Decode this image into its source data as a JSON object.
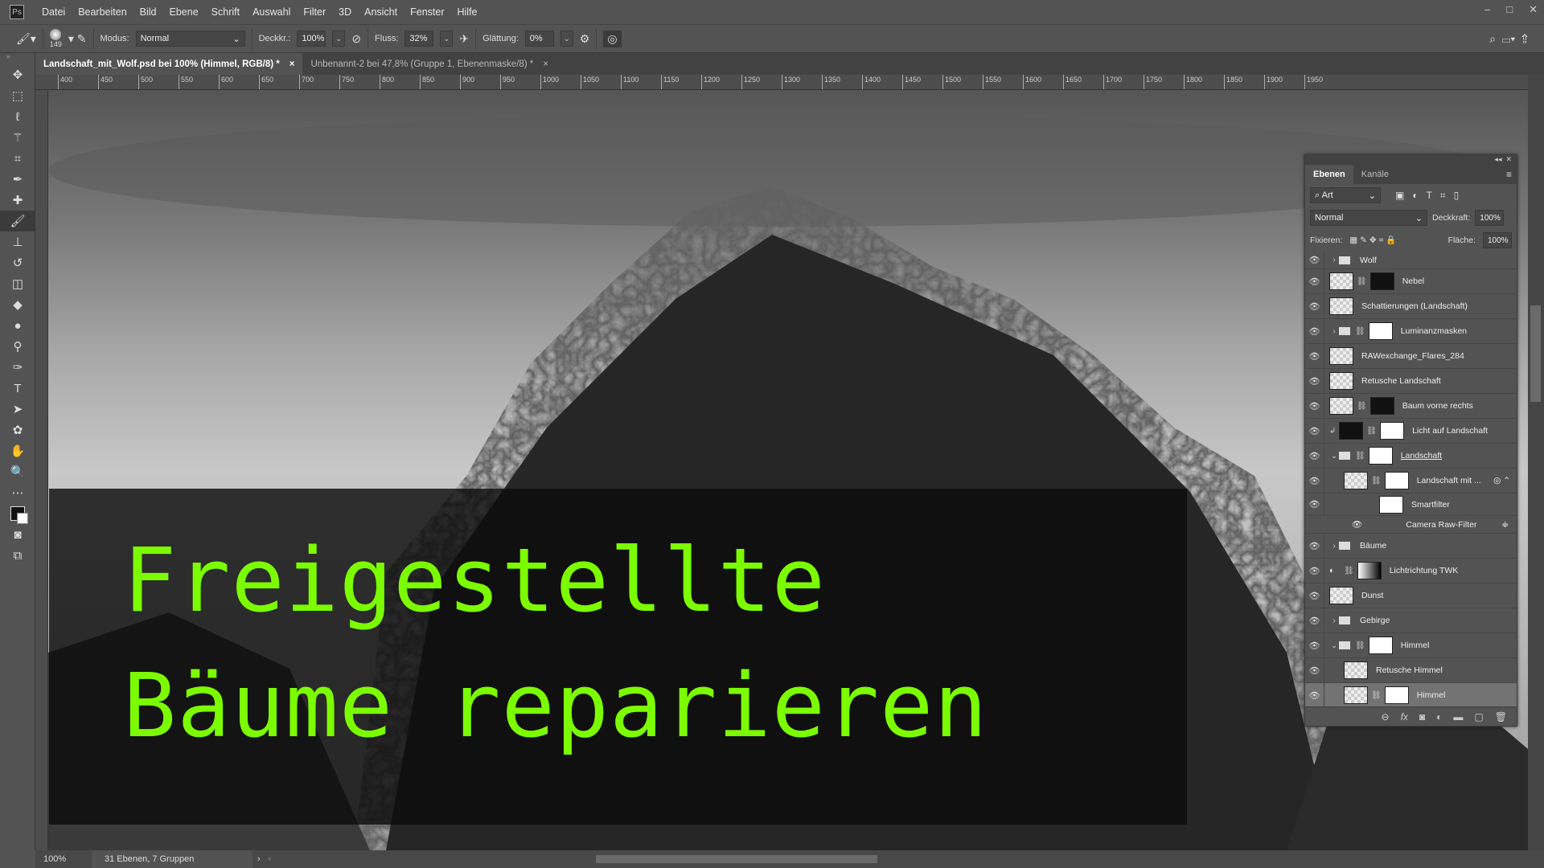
{
  "app": {
    "logo": "Ps",
    "window_controls": [
      "–",
      "□",
      "✕"
    ]
  },
  "menu": [
    "Datei",
    "Bearbeiten",
    "Bild",
    "Ebene",
    "Schrift",
    "Auswahl",
    "Filter",
    "3D",
    "Ansicht",
    "Fenster",
    "Hilfe"
  ],
  "options": {
    "brush_size": "149",
    "mode_label": "Modus:",
    "mode_value": "Normal",
    "opacity_label": "Deckkr.:",
    "opacity_value": "100%",
    "flow_label": "Fluss:",
    "flow_value": "32%",
    "smoothing_label": "Glättung:",
    "smoothing_value": "0%"
  },
  "tabs": [
    {
      "label": "Landschaft_mit_Wolf.psd bei 100% (Himmel, RGB/8) *",
      "active": true
    },
    {
      "label": "Unbenannt-2 bei 47,8% (Gruppe 1, Ebenenmaske/8) *",
      "active": false
    }
  ],
  "ruler": [
    "400",
    "450",
    "500",
    "550",
    "600",
    "650",
    "700",
    "750",
    "800",
    "850",
    "900",
    "950",
    "1000",
    "1050",
    "1100",
    "1150",
    "1200",
    "1250",
    "1300",
    "1350",
    "1400",
    "1450",
    "1500",
    "1550",
    "1600",
    "1650",
    "1700",
    "1750",
    "1800",
    "1850",
    "1900",
    "1950"
  ],
  "overlay": {
    "line1": "Freigestellte",
    "line2": "Bäume reparieren",
    "text_color": "#7cfc00"
  },
  "status": {
    "zoom": "100%",
    "info": "31 Ebenen, 7 Gruppen"
  },
  "layers_panel": {
    "tabs": [
      "Ebenen",
      "Kanäle"
    ],
    "filter": "Art",
    "blend_mode": "Normal",
    "opacity_label": "Deckkraft:",
    "opacity_value": "100%",
    "lock_label": "Fixieren:",
    "fill_label": "Fläche:",
    "fill_value": "100%",
    "layers": [
      {
        "name": "Wolf",
        "type": "group",
        "expanded": false,
        "indent": 0
      },
      {
        "name": "Nebel",
        "type": "layer-mask",
        "indent": 0
      },
      {
        "name": "Schattierungen (Landschaft)",
        "type": "layer",
        "indent": 0
      },
      {
        "name": "Luminanzmasken",
        "type": "group-mask",
        "expanded": false,
        "indent": 0
      },
      {
        "name": "RAWexchange_Flares_284",
        "type": "smart",
        "indent": 0
      },
      {
        "name": "Retusche Landschaft",
        "type": "layer",
        "indent": 0
      },
      {
        "name": "Baum vorne rechts",
        "type": "layer-mask",
        "indent": 0
      },
      {
        "name": "Licht auf Landschaft",
        "type": "clip-mask",
        "indent": 0
      },
      {
        "name": "Landschaft",
        "type": "group-mask",
        "expanded": true,
        "indent": 0
      },
      {
        "name": "Landschaft mit ...",
        "type": "smart-mask",
        "indent": 1
      },
      {
        "name": "Smartfilter",
        "type": "smartfilter",
        "indent": 2
      },
      {
        "name": "Camera Raw-Filter",
        "type": "filter",
        "indent": 2
      },
      {
        "name": "Bäume",
        "type": "group",
        "expanded": false,
        "indent": 0
      },
      {
        "name": "Lichtrichtung TWK",
        "type": "adjustment",
        "indent": 0
      },
      {
        "name": "Dunst",
        "type": "layer",
        "indent": 0
      },
      {
        "name": "Gebirge",
        "type": "group",
        "expanded": false,
        "indent": 0
      },
      {
        "name": "Himmel",
        "type": "group-mask",
        "expanded": true,
        "indent": 0
      },
      {
        "name": "Retusche Himmel",
        "type": "layer",
        "indent": 1
      },
      {
        "name": "Himmel",
        "type": "layer-mask",
        "indent": 1,
        "selected": true
      }
    ]
  }
}
